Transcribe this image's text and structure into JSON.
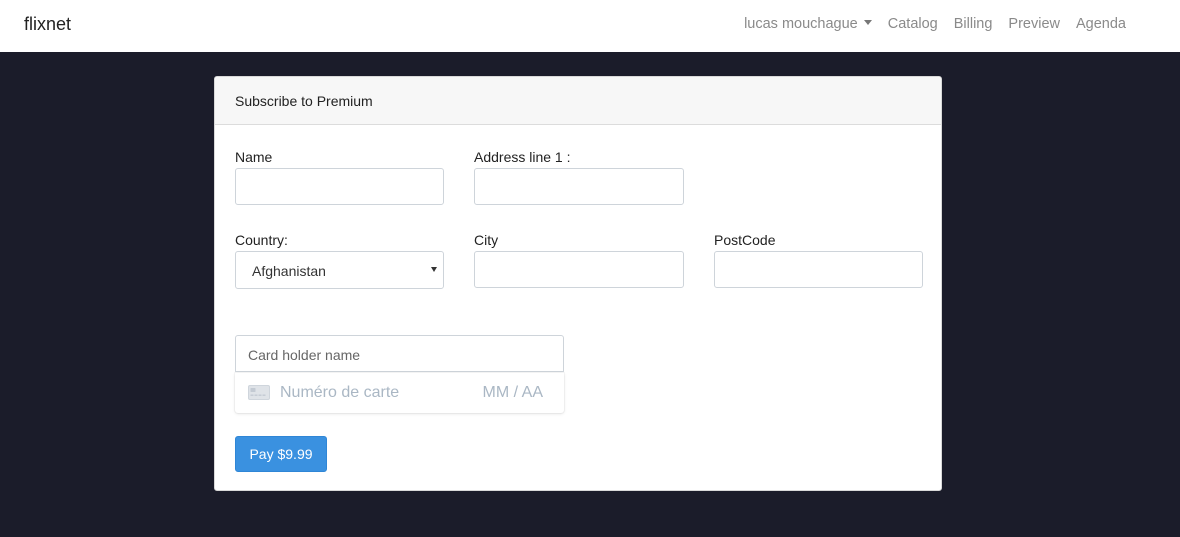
{
  "navbar": {
    "brand": "flixnet",
    "user_menu": "lucas mouchague",
    "links": [
      "Catalog",
      "Billing",
      "Preview",
      "Agenda"
    ]
  },
  "card": {
    "title": "Subscribe to Premium"
  },
  "form": {
    "name_label": "Name",
    "address_label": "Address line 1 :",
    "country_label": "Country:",
    "country_value": "Afghanistan",
    "city_label": "City",
    "postcode_label": "PostCode"
  },
  "payment": {
    "card_holder_placeholder": "Card holder name",
    "card_number_placeholder": "Numéro de carte",
    "expiry_placeholder": "MM / AA",
    "pay_button": "Pay $9.99",
    "icons": {
      "card": "credit-card-icon"
    }
  },
  "colors": {
    "page_background": "#1b1c2a",
    "primary": "#3a91e0"
  }
}
